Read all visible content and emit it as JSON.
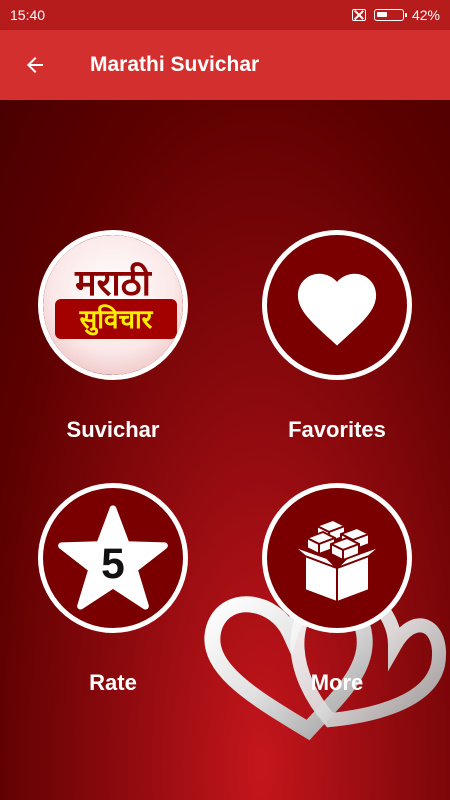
{
  "status_bar": {
    "time": "15:40",
    "battery_percent": "42%",
    "battery_level": 0.42,
    "icons": [
      "no-sim-icon",
      "battery-icon"
    ]
  },
  "toolbar": {
    "title": "Marathi Suvichar",
    "back_icon": "arrow-left-icon",
    "color": "#d32f2f"
  },
  "tiles": [
    {
      "label": "Suvichar",
      "icon": "marathi-suvichar-logo",
      "logo_line1": "मराठी",
      "logo_line2": "सुविचार"
    },
    {
      "label": "Favorites",
      "icon": "heart-icon"
    },
    {
      "label": "Rate",
      "icon": "star-icon",
      "icon_text": "5"
    },
    {
      "label": "More",
      "icon": "boxes-icon"
    }
  ],
  "colors": {
    "status_bar": "#b71c1c",
    "background": "#5a0000",
    "text": "#ffffff"
  }
}
